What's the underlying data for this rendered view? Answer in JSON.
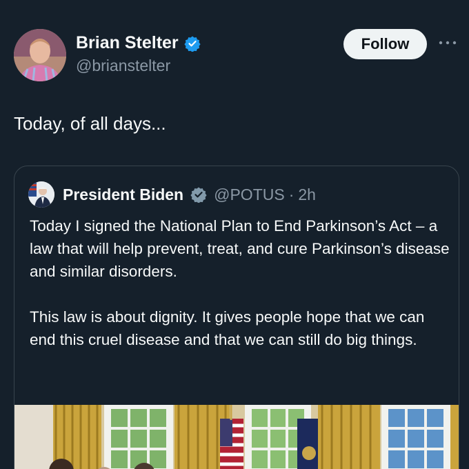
{
  "author": {
    "display_name": "Brian Stelter",
    "handle": "@brianstelter",
    "verified": true,
    "verified_color": "#1d9bf0"
  },
  "actions": {
    "follow_label": "Follow",
    "more_icon": "more-horizontal-icon"
  },
  "tweet": {
    "text": "Today, of all days..."
  },
  "quoted_tweet": {
    "display_name": "President Biden",
    "handle": "@POTUS",
    "separator": "·",
    "time": "2h",
    "badge": "gray-verified-badge-icon",
    "badge_color": "#829aab",
    "paragraphs": [
      "Today I signed the National Plan to End Parkinson’s Act – a law that will help prevent, treat, and cure Parkinson’s disease and similar disorders.",
      "This law is about dignity. It gives people hope that we can end this cruel disease and that we can still do big things."
    ]
  },
  "colors": {
    "background": "#15202b",
    "border": "#38444d",
    "secondary_text": "#8b98a5"
  }
}
